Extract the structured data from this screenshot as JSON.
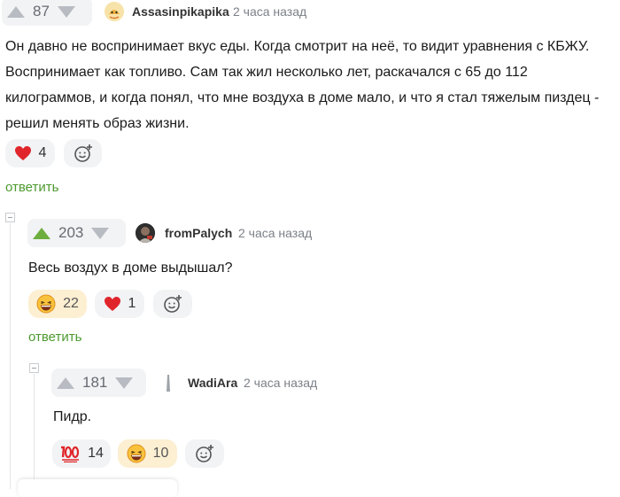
{
  "comments": [
    {
      "rating": "87",
      "author": "Assasinpikapika",
      "time": "2 часа назад",
      "lines": [
        "Он давно не воспринимает вкус еды. Когда смотрит на неё, то видит уравнения с КБЖУ.",
        "Воспринимает как топливо. Сам так жил несколько лет, раскачался с 65 до 112",
        "килограммов, и когда понял, что мне воздуха в доме мало, и что я стал тяжелым пиздец -",
        "решил менять образ жизни."
      ],
      "reactions": [
        {
          "icon": "heart-icon",
          "count": "4"
        }
      ],
      "reply_label": "ответить"
    },
    {
      "rating": "203",
      "author": "fromPalych",
      "time": "2 часа назад",
      "lines": [
        "Весь воздух в доме выдышал?"
      ],
      "reactions": [
        {
          "icon": "laughing-face-icon",
          "count": "22"
        },
        {
          "icon": "heart-icon",
          "count": "1"
        }
      ],
      "reply_label": "ответить"
    },
    {
      "rating": "181",
      "author": "WadiAra",
      "time": "2 часа назад",
      "lines": [
        "Пидр."
      ],
      "reactions": [
        {
          "icon": "hundred-points-icon",
          "count": "14"
        },
        {
          "icon": "laughing-face-icon",
          "count": "10"
        }
      ]
    }
  ],
  "colors": {
    "accent_green": "#4d9a2f",
    "upvote_active": "#6dae3f",
    "heart_red": "#e0262b",
    "reaction_bg": "#f2f3f5",
    "reaction_active_bg": "#fcefd2"
  }
}
